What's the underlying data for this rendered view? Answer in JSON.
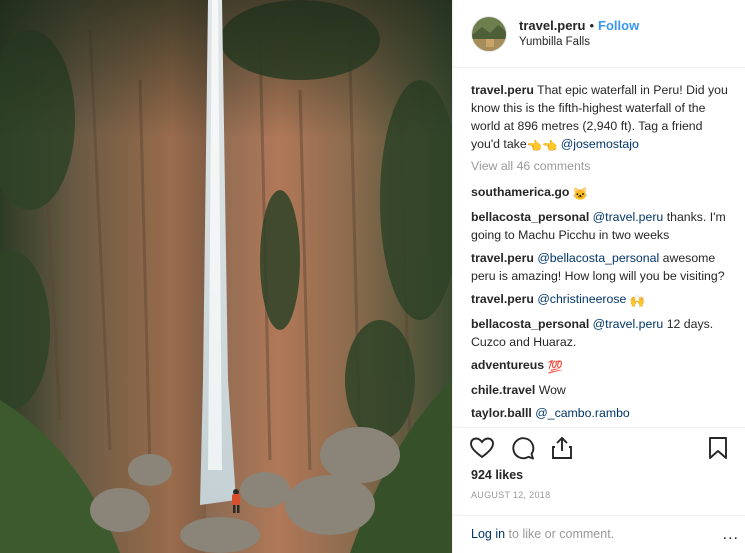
{
  "header": {
    "username": "travel.peru",
    "separator": "•",
    "follow_label": "Follow",
    "location": "Yumbilla Falls"
  },
  "caption": {
    "user": "travel.peru",
    "text": "That epic waterfall in Peru! Did you know this is the fifth-highest waterfall of the world at 896 metres (2,940 ft). Tag a friend you'd take",
    "emoji": "👈👈",
    "mention": "@josemostajo"
  },
  "view_all_label": "View all 46 comments",
  "comments": [
    {
      "user": "southamerica.go",
      "mention": "",
      "text": "",
      "emoji": "🐱"
    },
    {
      "user": "bellacosta_personal",
      "mention": "@travel.peru",
      "text": "thanks. I'm going to Machu Picchu in two weeks",
      "emoji": ""
    },
    {
      "user": "travel.peru",
      "mention": "@bellacosta_personal",
      "text": "awesome peru is amazing! How long will you be visiting?",
      "emoji": ""
    },
    {
      "user": "travel.peru",
      "mention": "@christineerose",
      "text": "",
      "emoji": "🙌"
    },
    {
      "user": "bellacosta_personal",
      "mention": "@travel.peru",
      "text": "12 days. Cuzco and Huaraz.",
      "emoji": ""
    },
    {
      "user": "adventureus",
      "mention": "",
      "text": "",
      "emoji": "💯"
    },
    {
      "user": "chile.travel",
      "mention": "",
      "text": "Wow",
      "emoji": ""
    },
    {
      "user": "taylor.balll",
      "mention": "@_cambo.rambo",
      "text": "",
      "emoji": ""
    }
  ],
  "likes_label": "924 likes",
  "date_label": "AUGUST 12, 2018",
  "login": {
    "link_label": "Log in",
    "rest": "to like or comment."
  },
  "more_label": "...",
  "icons": [
    "heart-icon",
    "comment-icon",
    "share-icon",
    "bookmark-icon"
  ]
}
